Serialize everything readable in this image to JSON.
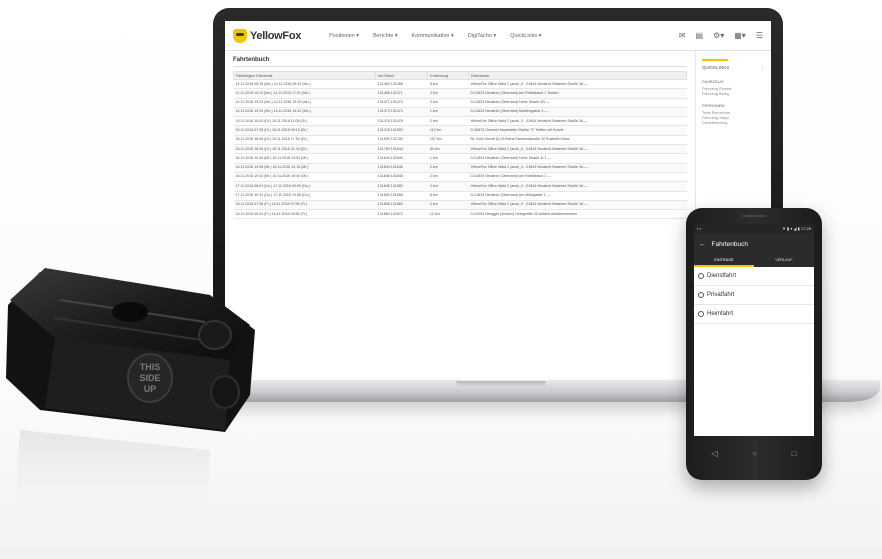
{
  "laptop": {
    "brand": "YellowFox",
    "nav": [
      "Positionen ▾",
      "Berichte ▾",
      "Kommunikation ▾",
      "DigiTacho ▾",
      "QuickLinks ▾"
    ],
    "page_title": "Fahrtenbuch",
    "table": {
      "headers": [
        "Fahrtbeginn Fahrtende",
        "km-Stand",
        "Entfernung",
        "Fahrtzweck"
      ],
      "rows": [
        {
          "time": "14.11.2016 09:15 (Mo.) 14.11.2016 09:43 (Mo.)",
          "km": "131460 131468",
          "dist": "8 km",
          "purpose": "YellowFox Office Wald 2 (ausb_0 - 01844 Neukirch Bratener Straße 3A —"
        },
        {
          "time": "11.11.2016 10:13 (Mo.) 14.11.2016 17:01 (Mo.)",
          "km": "131468 131471",
          "dist": "3 km",
          "purpose": "D-01833 Neukirch (Oberrand) Am Rütlesbach 1 Tanken"
        },
        {
          "time": "14.11.2016 19:23 (Mo.) 14.11.2016 19:28 (Mo.)",
          "km": "131471 131473",
          "dist": "2 km",
          "purpose": "D-01833 Neukirch (Oberrand) Hohe Straße 2N —"
        },
        {
          "time": "14.11.2016 19:33 (Mo.) 14.11.2016 19:42 (Mo.)",
          "km": "131473 131474",
          "dist": "1 km",
          "purpose": "D-01833 Neukirch (Oberrand) Mühlengasse 3 —"
        },
        {
          "time": "15.11.2016 10:03 (Di.) 15.11.2016 11:05 (Di.)",
          "km": "131476 131478",
          "dist": "2 km",
          "purpose": "YellowFox Office Wald 2 (ausb_0 - 01844 Neukirch Bratener Straße 3A —"
        },
        {
          "time": "15.11.2016 07:35 (Di.) 15.11.2016 09:15 (Di.)",
          "km": "131478 131590",
          "dist": "112 km",
          "purpose": "D-06675 Goseck Hauptweiler Straße 72 Treffen mit Kunde"
        },
        {
          "time": "15.11.2016 16:45 (Di.) 15.11.2016 17:50 (Di.)",
          "km": "131590 131780",
          "dist": "107 km",
          "purpose": "RL Gold Glendi (D-01/Hens Raubendstraße 32 Rustfahrt Esse"
        },
        {
          "time": "16.11.2016 18:26 (Di.) 16.11.2016 21:44 (Di.)",
          "km": "131780 131844",
          "dist": "64 km",
          "purpose": "YellowFox Office Wald 2 (ausb_0 - 01844 Neukirch Bratener Straße 3A —"
        },
        {
          "time": "16.11.2016 10:45 (Mi.) 16.11.2016 13:53 (Mi.)",
          "km": "131844 131844",
          "dist": "1 km",
          "purpose": "D-01844 Neukirch (Oberrand) Hohe Straße 1LT —"
        },
        {
          "time": "16.11.2016 14:08 (Mi.) 16.11.2016 14:15 (Mi.)",
          "km": "131844 131846",
          "dist": "2 km",
          "purpose": "YellowFox Office Wald 2 (ausb_0 - 01844 Neukirch Bratener Straße 3A —"
        },
        {
          "time": "16.11.2016 19:32 (Mi.) 16.11.2016 19:40 (Mi.)",
          "km": "131846 131848",
          "dist": "2 km",
          "purpose": "D-01833 Neukirch (Oberrand) Am Rütlesbach 1 —"
        },
        {
          "time": "17.11.2016 08:01 (Do.) 17.11.2016 09:09 (Do.)",
          "km": "131848 131850",
          "dist": "2 km",
          "purpose": "YellowFox Office Wald 2 (ausb_0 - 01844 Neukirch Bratener Straße 3A —"
        },
        {
          "time": "17.11.2016 19:31 (Do.) 17.11.2016 19:38 (Do.)",
          "km": "131850 131858",
          "dist": "8 km",
          "purpose": "D-01833 Neukirch (Oberrand) Am Mühlgasse 1 —"
        },
        {
          "time": "18.11.2016 07:38 (Fr.) 18.11.2016 07:55 (Fr.)",
          "km": "131858 131860",
          "dist": "2 km",
          "purpose": "YellowFox Office Wald 2 (ausb_0 - 01844 Neukirch Bratener Straße 3A —"
        },
        {
          "time": "18.11.2016 09:44 (Fr.) 18.11.2016 09:56 (Fr.)",
          "km": "131860 131872",
          "dist": "12 km",
          "purpose": "D-01093 Neugger (Andorn) Lietegrottle 20 Anfahrt Addstrumentzen"
        }
      ]
    },
    "quicklinks": {
      "title": "QUICKLINKS",
      "sections": [
        {
          "title": "FAHRZEUG",
          "links": [
            "Fahrzeug Einsatz",
            "Fahrzeug Beleg"
          ]
        },
        {
          "title": "PERSONEN",
          "links": [
            "Taxis Recherche",
            "Fahrzeug Stapo",
            "Dieselfahrzeug"
          ]
        }
      ]
    }
  },
  "phone": {
    "status_right": "▼ ▮ ▾ ◢ ▮ 17:26",
    "title": "Fahrtenbuch",
    "back_icon": "←",
    "tabs": [
      "EINTRAGE",
      "VERLAUF"
    ],
    "options": [
      "Dienstfahrt",
      "Privatfahrt",
      "Heimfahrt"
    ],
    "nav": [
      "◁",
      "○",
      "□"
    ]
  },
  "tracker": {
    "label_lines": [
      "THIS",
      "SIDE",
      "UP"
    ]
  },
  "colors": {
    "accent": "#f2c300",
    "app_bar": "#2b2b2b",
    "device_body": "#1a1a1a"
  }
}
